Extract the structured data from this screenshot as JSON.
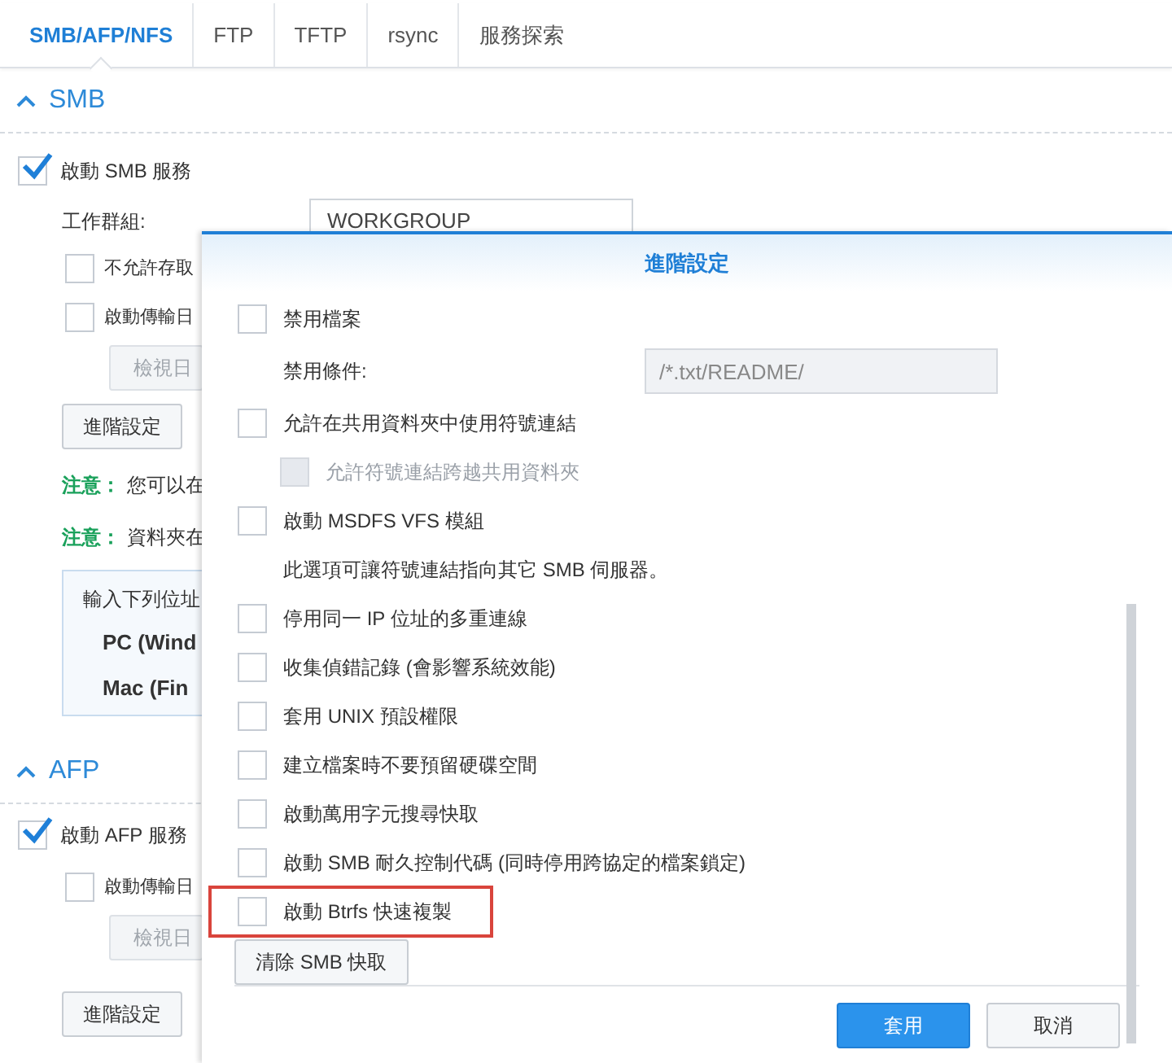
{
  "tabs": [
    {
      "label": "SMB/AFP/NFS",
      "selected": true
    },
    {
      "label": "FTP",
      "selected": false
    },
    {
      "label": "TFTP",
      "selected": false
    },
    {
      "label": "rsync",
      "selected": false
    },
    {
      "label": "服務探索",
      "selected": false
    }
  ],
  "smb": {
    "title": "SMB",
    "expanded": true,
    "enable": {
      "label": "啟動 SMB 服務",
      "checked": true
    },
    "workgroup": {
      "label": "工作群組:",
      "value": "WORKGROUP"
    },
    "options": [
      {
        "label": "不允許存取",
        "checked": false
      },
      {
        "label": "啟動傳輸日",
        "checked": false
      }
    ],
    "view_log_button": "檢視日",
    "advanced_button": "進階設定",
    "notes": [
      {
        "prefix": "注意：",
        "text": "您可以在"
      },
      {
        "prefix": "注意：",
        "text": "資料夾在"
      }
    ],
    "address_box": {
      "intro": "輸入下列位址",
      "lines": [
        "PC (Wind",
        "Mac (Fin"
      ]
    }
  },
  "afp": {
    "title": "AFP",
    "expanded": true,
    "enable": {
      "label": "啟動 AFP 服務",
      "checked": true
    },
    "options": [
      {
        "label": "啟動傳輸日",
        "checked": false
      }
    ],
    "view_log_button": "檢視日",
    "advanced_button": "進階設定"
  },
  "dialog": {
    "title": "進階設定",
    "items": [
      {
        "kind": "checkbox",
        "label": "禁用檔案",
        "checked": false,
        "disabled": false,
        "highlighted": false,
        "children": [
          {
            "kind": "field",
            "label": "禁用條件:",
            "value": "/*.txt/README/"
          }
        ]
      },
      {
        "kind": "checkbox",
        "label": "允許在共用資料夾中使用符號連結",
        "checked": false,
        "disabled": false,
        "highlighted": false,
        "children": [
          {
            "kind": "checkbox",
            "label": "允許符號連結跨越共用資料夾",
            "checked": false,
            "disabled": true,
            "highlighted": false
          }
        ]
      },
      {
        "kind": "checkbox",
        "label": "啟動 MSDFS VFS 模組",
        "checked": false,
        "disabled": false,
        "highlighted": false,
        "children": [
          {
            "kind": "note",
            "label": "此選項可讓符號連結指向其它 SMB 伺服器。"
          }
        ]
      },
      {
        "kind": "checkbox",
        "label": "停用同一 IP 位址的多重連線",
        "checked": false,
        "disabled": false,
        "highlighted": false
      },
      {
        "kind": "checkbox",
        "label": "收集偵錯記錄 (會影響系統效能)",
        "checked": false,
        "disabled": false,
        "highlighted": false
      },
      {
        "kind": "checkbox",
        "label": "套用 UNIX 預設權限",
        "checked": false,
        "disabled": false,
        "highlighted": false
      },
      {
        "kind": "checkbox",
        "label": "建立檔案時不要預留硬碟空間",
        "checked": false,
        "disabled": false,
        "highlighted": false
      },
      {
        "kind": "checkbox",
        "label": "啟動萬用字元搜尋快取",
        "checked": false,
        "disabled": false,
        "highlighted": false
      },
      {
        "kind": "checkbox",
        "label": "啟動 SMB 耐久控制代碼 (同時停用跨協定的檔案鎖定)",
        "checked": false,
        "disabled": false,
        "highlighted": false
      },
      {
        "kind": "checkbox",
        "label": "啟動 Btrfs 快速複製",
        "checked": false,
        "disabled": false,
        "highlighted": true
      }
    ],
    "clear_button": "清除 SMB 快取",
    "buttons": [
      {
        "label": "套用",
        "kind": "primary"
      },
      {
        "label": "取消",
        "kind": "secondary"
      }
    ]
  }
}
